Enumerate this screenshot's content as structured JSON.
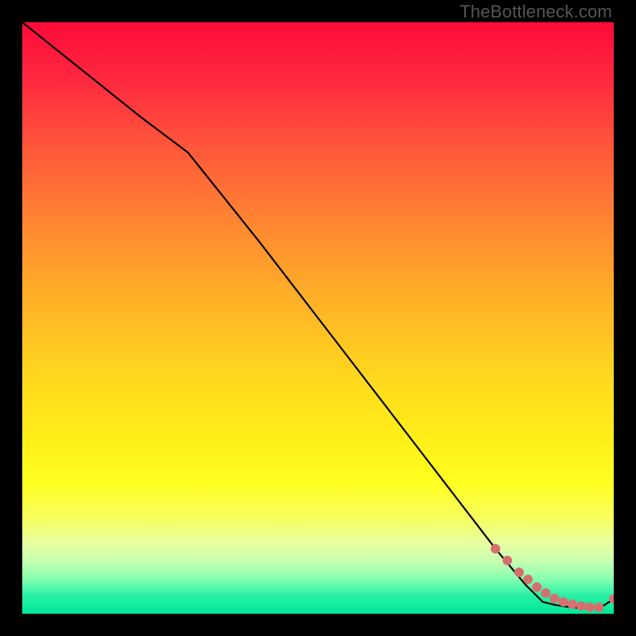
{
  "watermark": "TheBottleneck.com",
  "colors": {
    "frame": "#000000",
    "line": "#000000",
    "dot": "#d6706e",
    "grad_top": "#ff0a3a",
    "grad_bottom": "#00e89a"
  },
  "chart_data": {
    "type": "line",
    "title": "",
    "xlabel": "",
    "ylabel": "",
    "xlim": [
      0,
      100
    ],
    "ylim": [
      0,
      100
    ],
    "grid": false,
    "legend": false,
    "x": [
      0,
      10,
      20,
      28,
      40,
      50,
      60,
      70,
      80,
      85,
      88,
      90,
      92,
      94,
      96,
      98,
      100
    ],
    "values": [
      100,
      92,
      84,
      78,
      63,
      50,
      37,
      24,
      11,
      5,
      2,
      1.5,
      1.2,
      1.0,
      1.0,
      1.2,
      2.5
    ],
    "dots_x": [
      80,
      82,
      84,
      85.5,
      87,
      88.5,
      90,
      91.5,
      93,
      94.5,
      96,
      97.5,
      100
    ],
    "dots_y": [
      11,
      9,
      7,
      5.8,
      4.5,
      3.5,
      2.6,
      2.0,
      1.6,
      1.3,
      1.1,
      1.1,
      2.5
    ]
  }
}
